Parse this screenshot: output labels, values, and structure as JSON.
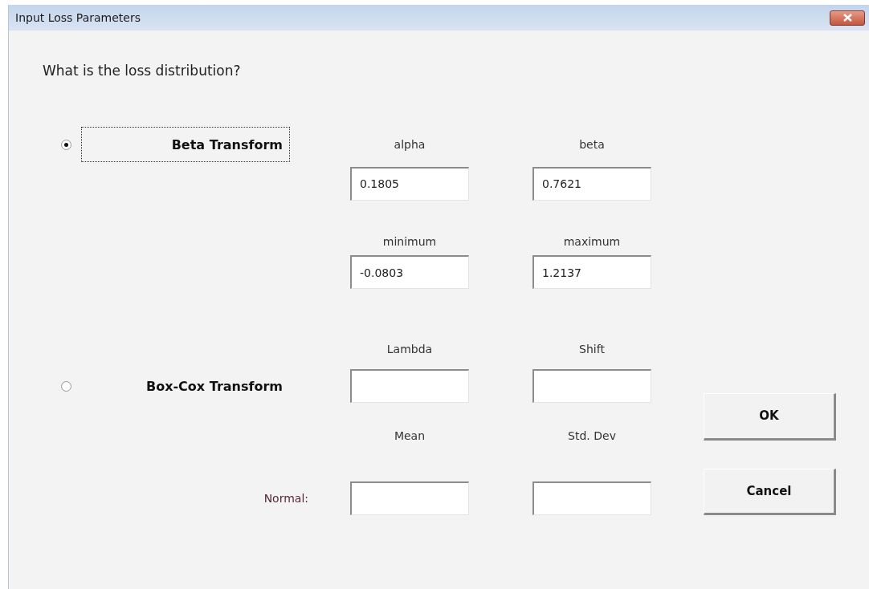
{
  "window": {
    "title": "Input Loss Parameters"
  },
  "question": "What is the loss distribution?",
  "options": [
    {
      "label": "Beta Transform",
      "selected": true,
      "focused": true
    },
    {
      "label": "Box-Cox Transform",
      "selected": false,
      "focused": false
    }
  ],
  "beta_fields": [
    [
      {
        "label": "alpha",
        "value": "0.1805"
      },
      {
        "label": "beta",
        "value": "0.7621"
      }
    ],
    [
      {
        "label": "minimum",
        "value": "-0.0803"
      },
      {
        "label": "maximum",
        "value": "1.2137"
      }
    ]
  ],
  "boxcox_fields": [
    {
      "label": "Lambda"
    },
    {
      "label": "Shift"
    }
  ],
  "normal": {
    "label": "Normal:",
    "fields": [
      {
        "label": "Mean"
      },
      {
        "label": "Std. Dev"
      }
    ]
  },
  "buttons": [
    "OK",
    "Cancel"
  ]
}
